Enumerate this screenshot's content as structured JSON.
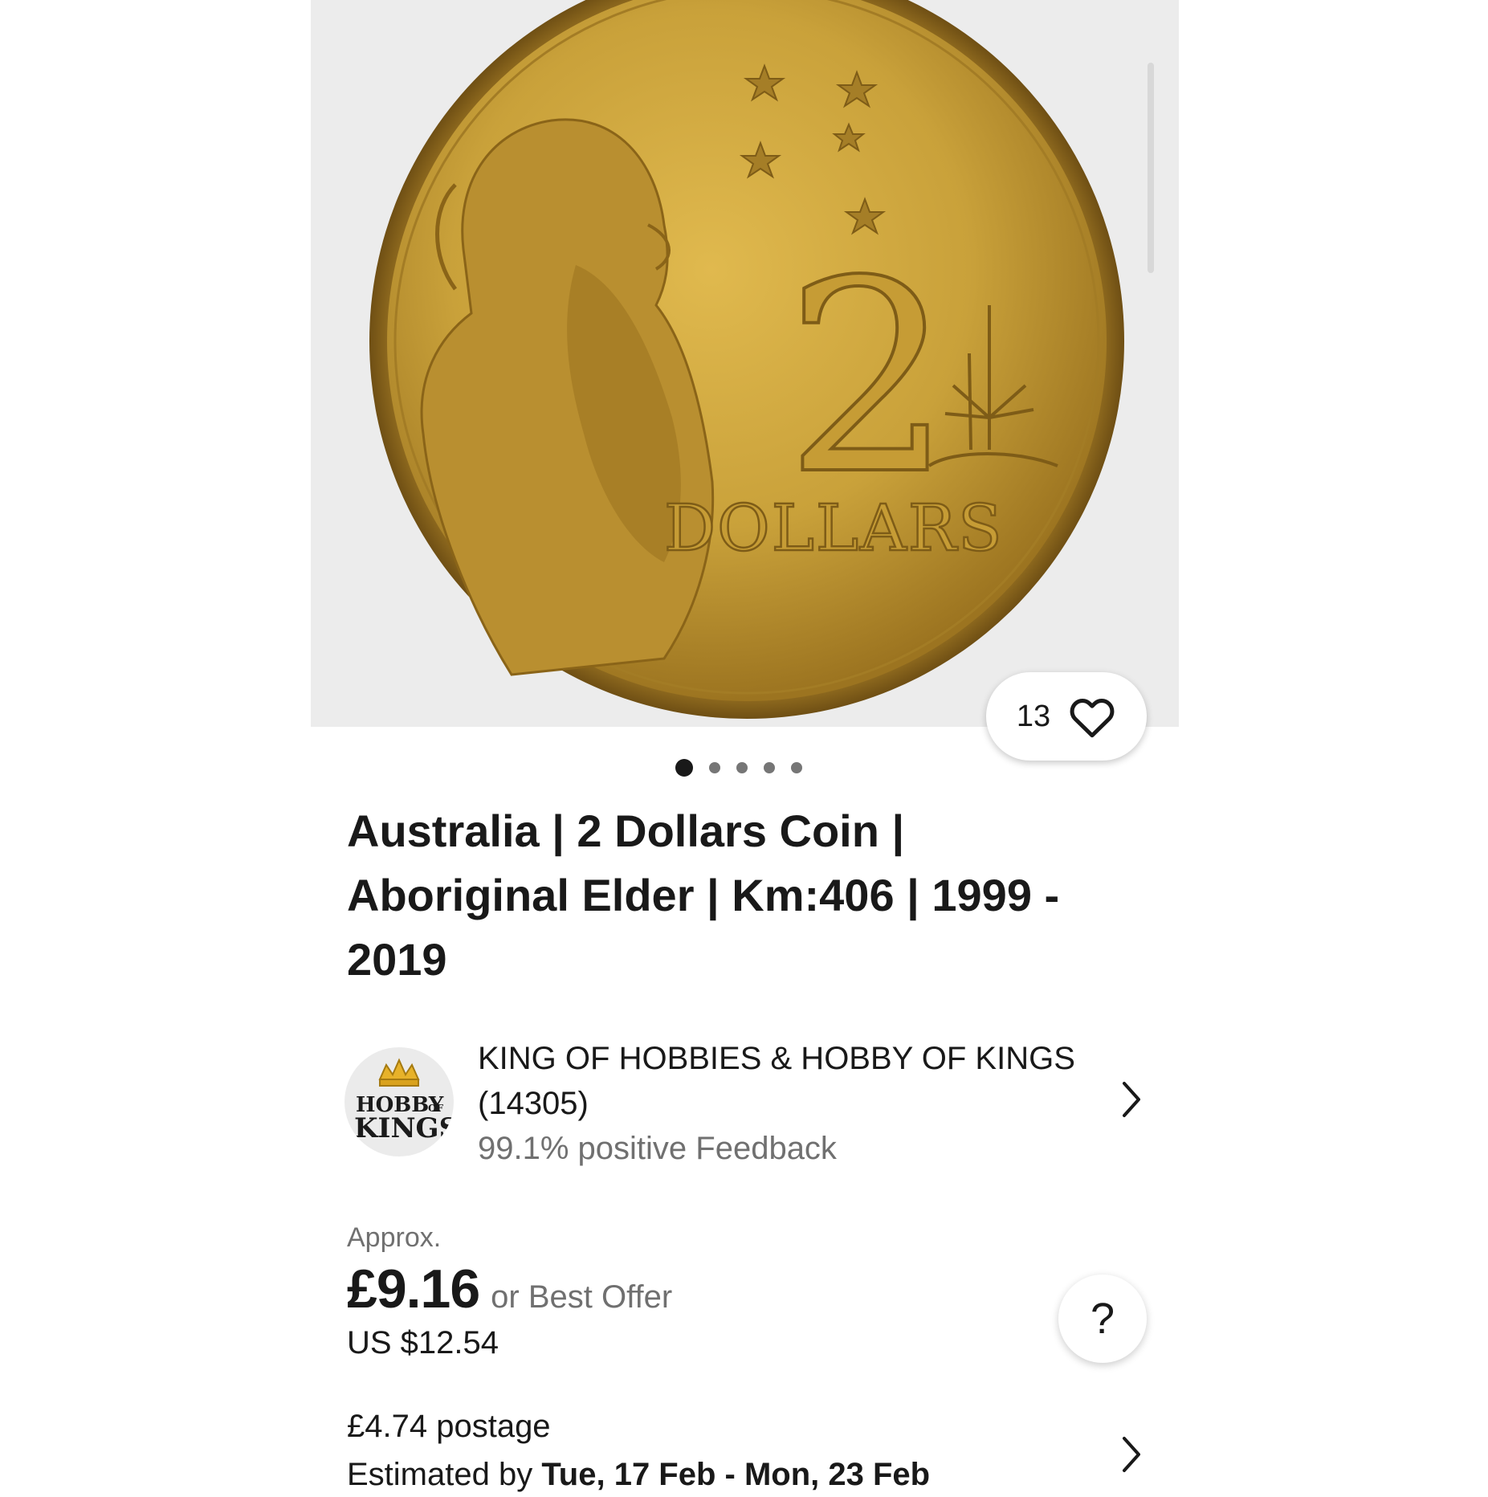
{
  "gallery": {
    "image_alt": "Australia 2 Dollars coin reverse",
    "coin_value_text": "2",
    "coin_denomination_text": "DOLLARS",
    "watch_count": "13",
    "photo_count": 5,
    "active_photo_index": 0
  },
  "listing": {
    "title": "Australia | 2 Dollars Coin | Aboriginal Elder | Km:406 | 1999 - 2019"
  },
  "seller": {
    "logo_text_top": "HOBBY",
    "logo_text_of": "OF",
    "logo_text_bottom": "KINGS",
    "name": "KING OF HOBBIES & HOBBY OF KINGS (14305)",
    "feedback": "99.1% positive Feedback"
  },
  "price": {
    "approx_label": "Approx.",
    "amount": "£9.16",
    "offer_label": "or Best Offer",
    "usd_amount": "US $12.54"
  },
  "help": {
    "label": "?"
  },
  "shipping": {
    "postage": "£4.74 postage",
    "estimate_prefix": "Estimated by ",
    "estimate_dates": "Tue, 17 Feb - Mon, 23 Feb"
  },
  "colors": {
    "text_primary": "#191919",
    "text_secondary": "#707070",
    "gallery_bg": "#ececec",
    "coin_gold": "#c9a13a"
  },
  "icons": {
    "watch": "heart-icon",
    "seller_chevron": "chevron-right-icon",
    "shipping_chevron": "chevron-right-icon",
    "help": "question-icon"
  }
}
